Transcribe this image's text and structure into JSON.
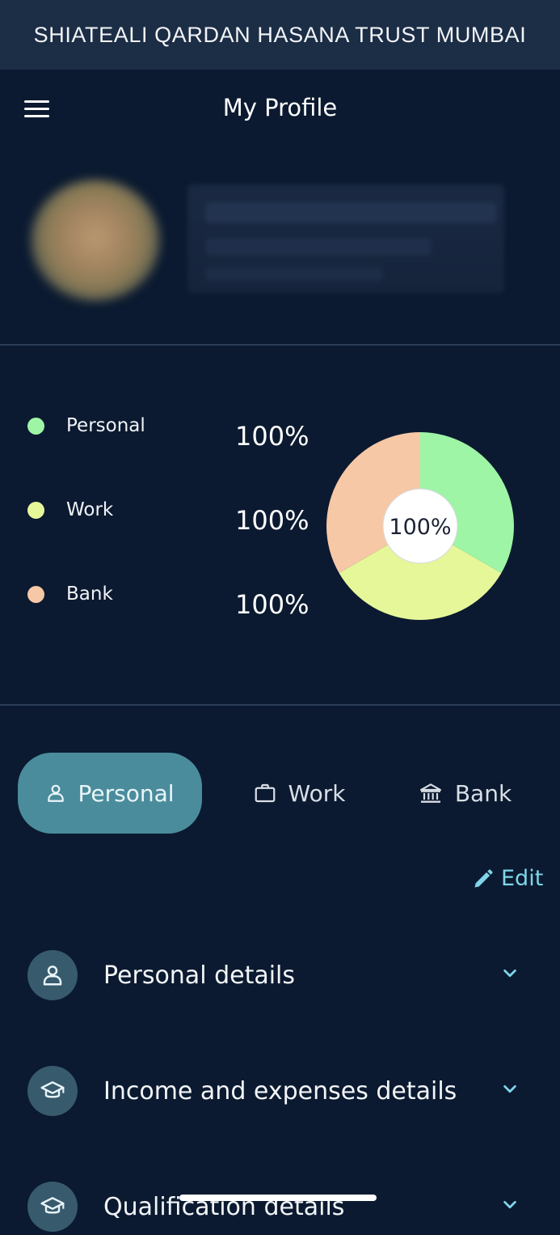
{
  "app": {
    "title": "SHIATEALI QARDAN HASANA TRUST MUMBAI"
  },
  "header": {
    "title": "My Profile",
    "menu_icon": "hamburger-menu-icon"
  },
  "profile": {
    "avatar": "blurred-avatar",
    "name": ""
  },
  "completion": {
    "legend": [
      {
        "label": "Personal",
        "value": "100%",
        "color": "#9ef5a6"
      },
      {
        "label": "Work",
        "value": "100%",
        "color": "#e6f79a"
      },
      {
        "label": "Bank",
        "value": "100%",
        "color": "#f7c8a6"
      }
    ],
    "center_label": "100%"
  },
  "chart_data": {
    "type": "pie",
    "categories": [
      "Personal",
      "Work",
      "Bank"
    ],
    "values": [
      100,
      100,
      100
    ],
    "center_label": "100%",
    "colors": [
      "#9ef5a6",
      "#e6f79a",
      "#f7c8a6"
    ]
  },
  "tabs": [
    {
      "label": "Personal",
      "icon": "user-icon",
      "active": true
    },
    {
      "label": "Work",
      "icon": "briefcase-icon",
      "active": false
    },
    {
      "label": "Bank",
      "icon": "bank-icon",
      "active": false
    }
  ],
  "edit": {
    "label": "Edit",
    "icon": "pencil-icon",
    "color": "#7fd5ea"
  },
  "sections": [
    {
      "label": "Personal details",
      "icon": "user-icon"
    },
    {
      "label": "Income and expenses details",
      "icon": "graduation-cap-icon"
    },
    {
      "label": "Qualification details",
      "icon": "graduation-cap-icon"
    }
  ],
  "colors": {
    "background": "#0b1a30",
    "topbar": "#1c2d46",
    "accent": "#4a8c9c"
  }
}
